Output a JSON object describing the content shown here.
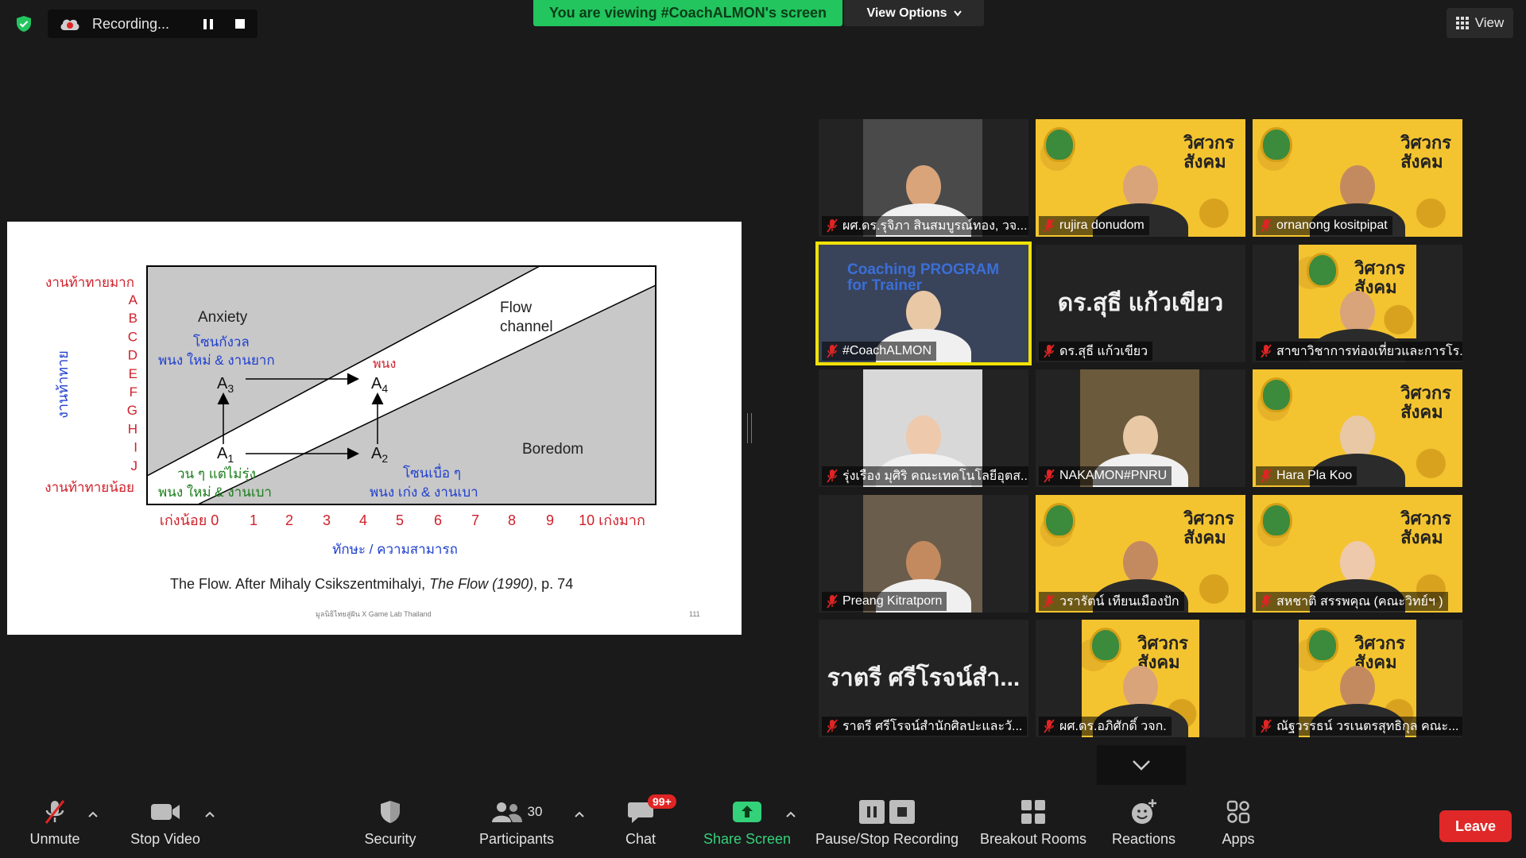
{
  "topbar": {
    "recording_label": "Recording...",
    "viewing_banner": "You are viewing #CoachALMON's screen",
    "view_options": "View Options",
    "view_label": "View"
  },
  "slide": {
    "y_axis_label": "งานท้าทาย",
    "y_top": "งานท้าทายมาก",
    "y_bottom": "งานท้าทายน้อย",
    "y_letters": [
      "A",
      "B",
      "C",
      "D",
      "E",
      "F",
      "G",
      "H",
      "I",
      "J"
    ],
    "x_ticks": [
      "เก่งน้อย 0",
      "1",
      "2",
      "3",
      "4",
      "5",
      "6",
      "7",
      "8",
      "9",
      "10 เก่งมาก"
    ],
    "x_axis_label": "ทักษะ / ความสามารถ",
    "anxiety": "Anxiety",
    "anxiety_th": "โซนกังวล",
    "anxiety_desc": "พนง ใหม่ & งานยาก",
    "flow_1": "Flow",
    "flow_2": "channel",
    "boredom": "Boredom",
    "boredom_th": "โซนเบื่อ ๆ",
    "boredom_desc": "พนง เก่ง & งานเบา",
    "a1_desc1": "วน ๆ แต่ไม่รุ่ง",
    "a1_desc2": "พนง ใหม่ & งานเบา",
    "a4_note": "พนง",
    "a1": "A",
    "a2": "A",
    "a3": "A",
    "a4": "A",
    "s1": "1",
    "s2": "2",
    "s3": "3",
    "s4": "4",
    "caption_prefix": "The Flow.  After Mihaly Csikszentmihalyi, ",
    "caption_italic": "The Flow (1990)",
    "caption_suffix": ", p. 74",
    "footer": "มูลนิธิไทยสู่ฝัน X Game Lab Thailand",
    "page_num": "111"
  },
  "participants": [
    {
      "name": "ผศ.ดร.รุจิภา สินสมบูรณ์ทอง, วจ...",
      "kind": "video"
    },
    {
      "name": "rujira donudom",
      "kind": "poster"
    },
    {
      "name": "ornanong kositpipat",
      "kind": "poster"
    },
    {
      "name": "#CoachALMON",
      "kind": "speaker",
      "overlay": "Coaching PROGRAM for Trainer"
    },
    {
      "name": "ดร.สุธี  แก้วเขียว",
      "kind": "text",
      "big": "ดร.สุธี  แก้วเขียว"
    },
    {
      "name": "สาขาวิชาการท่องเที่ยวและการโร...",
      "kind": "poster"
    },
    {
      "name": "รุ่งเรือง มุศิริ คณะเทคโนโลยีอุตส...",
      "kind": "video"
    },
    {
      "name": "NAKAMON#PNRU",
      "kind": "video"
    },
    {
      "name": "Hara Pla Koo",
      "kind": "poster"
    },
    {
      "name": "Preang Kitratporn",
      "kind": "video"
    },
    {
      "name": "วรารัตน์ เทียนเมืองปัก",
      "kind": "poster"
    },
    {
      "name": "สหชาติ สรรพคุณ (คณะวิทย์ฯ )",
      "kind": "poster"
    },
    {
      "name": "ราตรี   ศรีโรจน์สำนักศิลปะและวั...",
      "kind": "text",
      "big": "ราตรี   ศรีโรจน์สำ..."
    },
    {
      "name": "ผศ.ดร.อภิศักดิ์ วจก.",
      "kind": "poster"
    },
    {
      "name": "ณัฐวรรธน์ วรเนตรสุทธิกุล คณะ...",
      "kind": "poster"
    }
  ],
  "poster_brand": "วิศวกร\nสังคม",
  "toolbar": {
    "unmute": "Unmute",
    "stop_video": "Stop Video",
    "security": "Security",
    "participants": "Participants",
    "participants_count": "30",
    "chat": "Chat",
    "chat_badge": "99+",
    "share_screen": "Share Screen",
    "pause_stop_recording": "Pause/Stop Recording",
    "breakout_rooms": "Breakout Rooms",
    "reactions": "Reactions",
    "apps": "Apps",
    "leave": "Leave"
  },
  "colors": {
    "banner_green": "#22c55e",
    "speaker_outline": "#f2e205",
    "leave_red": "#e02828",
    "share_green": "#33d17a"
  }
}
